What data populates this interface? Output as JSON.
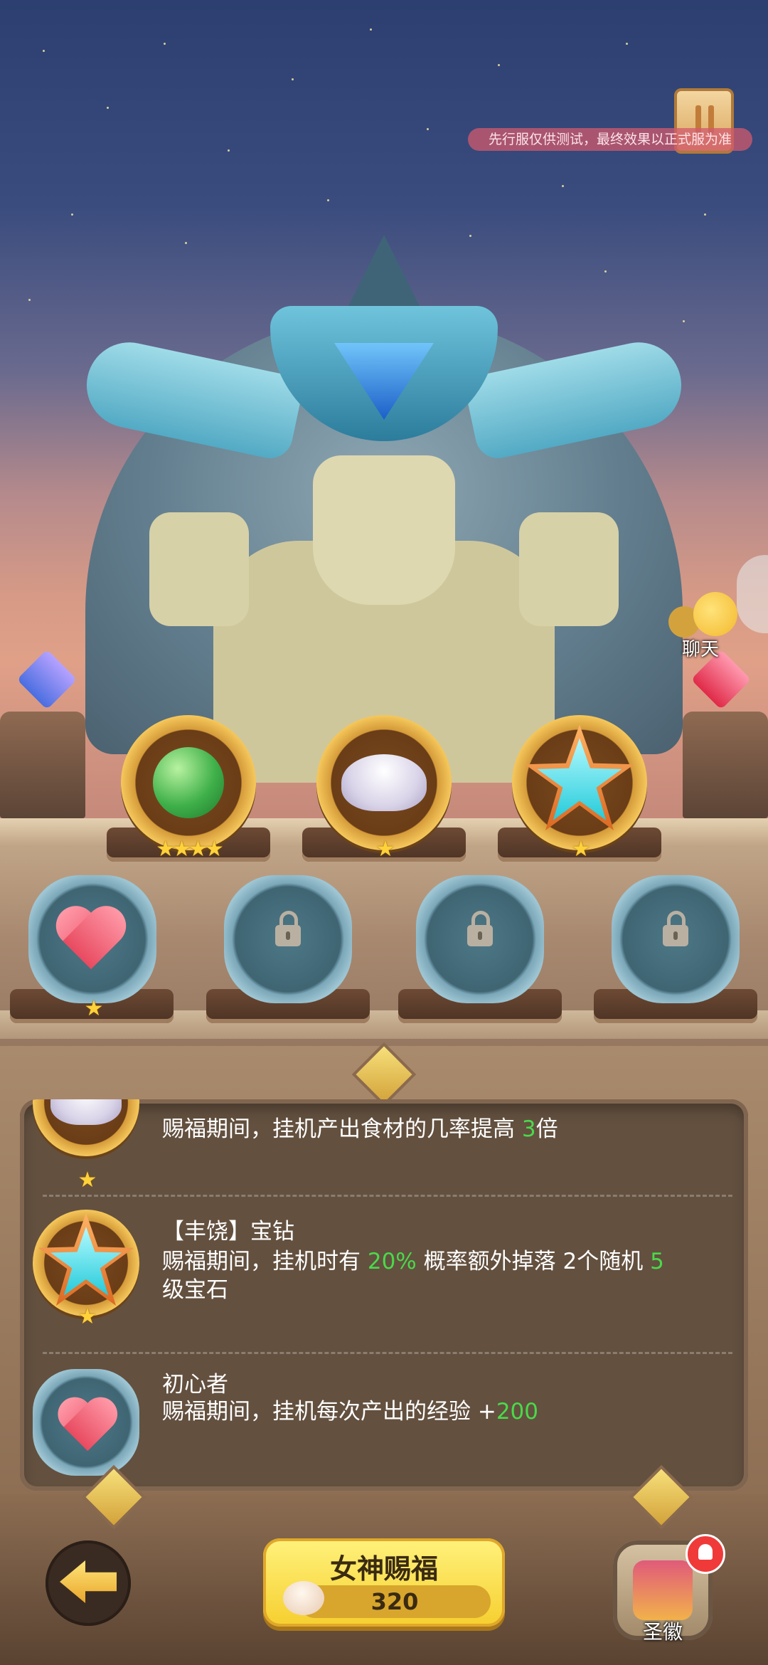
{
  "notice": {
    "text": "先行服仅供测试，最终效果以正式服为准"
  },
  "chat": {
    "label": "聊天"
  },
  "top_badges": [
    {
      "icon": "leaf-icon",
      "stars": "★★★★"
    },
    {
      "icon": "shell-icon",
      "stars": "★"
    },
    {
      "icon": "star-icon",
      "stars": "★"
    }
  ],
  "slots": [
    {
      "icon": "heart-icon",
      "stars": "★",
      "locked": false
    },
    {
      "icon": "lock-icon",
      "locked": true
    },
    {
      "icon": "lock-icon",
      "locked": true
    },
    {
      "icon": "lock-icon",
      "locked": true
    }
  ],
  "info": {
    "row1": {
      "desc_a": "赐福期间，挂机产出食材的几率提高 ",
      "desc_hl": "3",
      "desc_b": "倍",
      "stars": "★"
    },
    "row2": {
      "title": "【丰饶】宝钻",
      "desc_a": "赐福期间，挂机时有 ",
      "desc_hl": "20%",
      "desc_b": " 概率额外掉落 2个随机 ",
      "desc_hl2": "5",
      "desc_c": "级宝石",
      "stars": "★"
    },
    "row3": {
      "title": "初心者",
      "desc_a": "赐福期间，挂机每次产出的经验 +",
      "desc_hl": "200"
    }
  },
  "bottom": {
    "bless_label": "女神赐福",
    "bless_cost": "320",
    "emblem_label": "圣徽"
  },
  "colors": {
    "highlight": "#4ad94a",
    "button_gold": "#f6cf2f",
    "panel": "#63503f"
  }
}
